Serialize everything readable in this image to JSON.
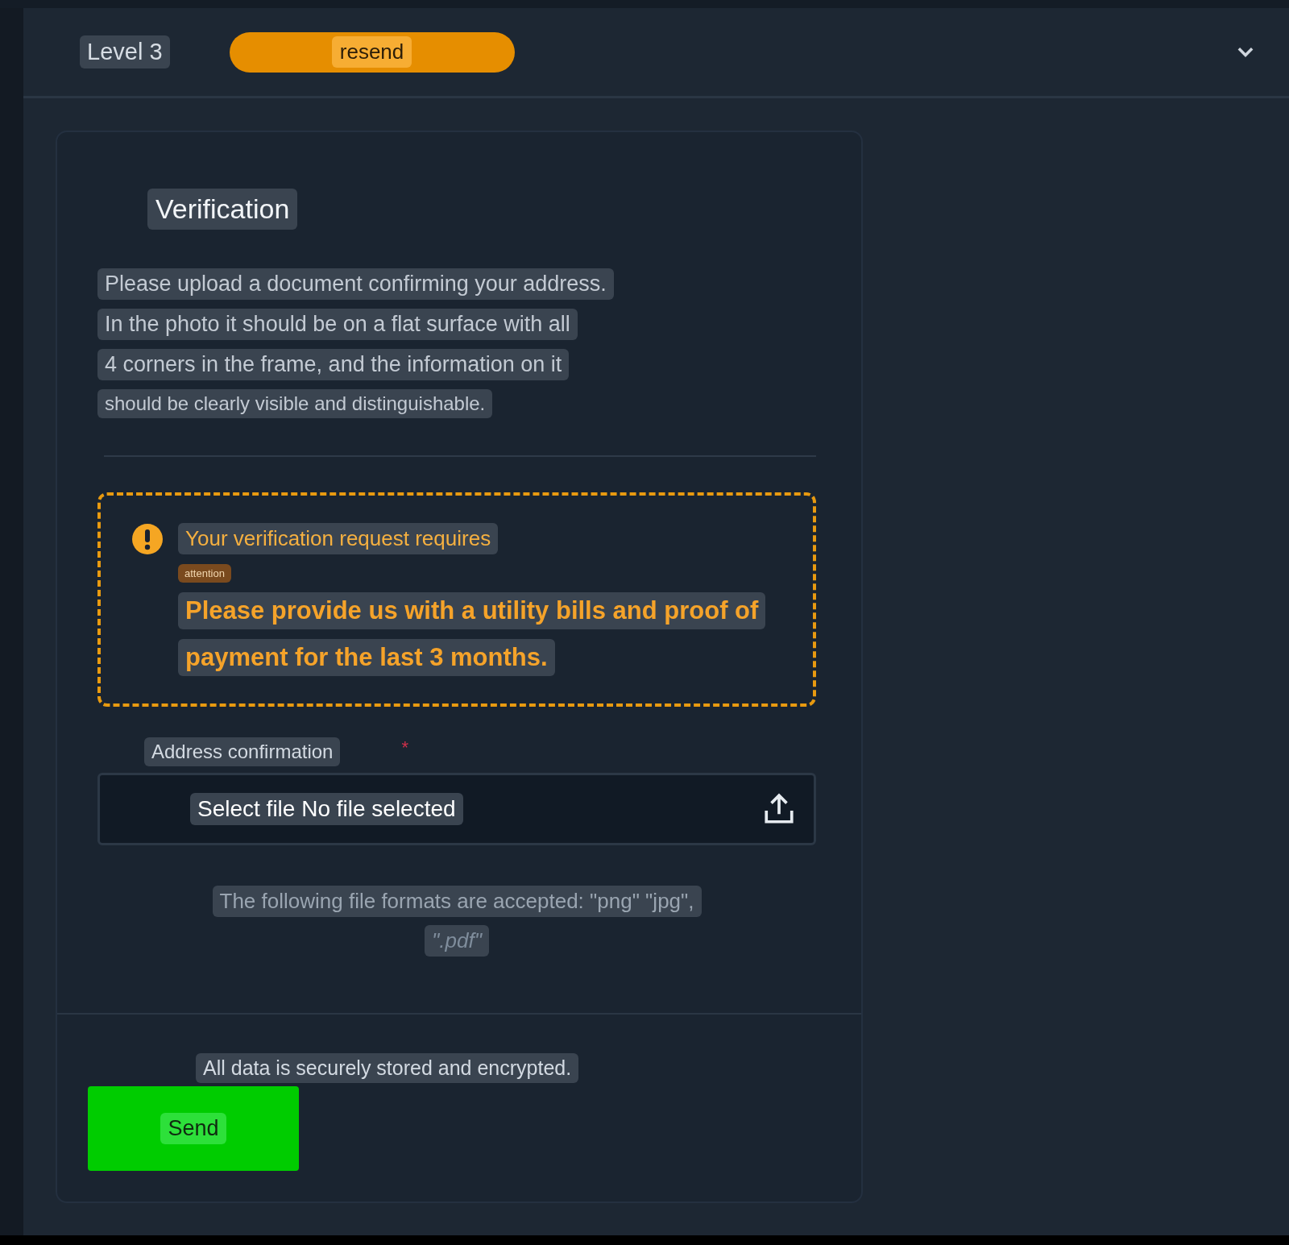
{
  "header": {
    "level": "Level 3",
    "status": "resend",
    "expanded": true
  },
  "card": {
    "title": "Verification",
    "description": [
      "Please upload a document confirming your address.",
      "In the photo it should be on a flat surface with all",
      "4 corners in the frame, and the information on it",
      "should be clearly visible and distinguishable."
    ],
    "warning": {
      "title": "Your verification request requires",
      "badge": "attention",
      "message": [
        "Please provide us with a utility bills and proof of",
        "payment for the last 3 months."
      ]
    },
    "field": {
      "label": "Address confirmation",
      "required_mark": "*",
      "value": "Select file No file selected"
    },
    "formats": [
      "The following file formats are accepted: \"png\" \"jpg\",",
      "\".pdf\""
    ],
    "footer_note": "All data is securely stored and encrypted.",
    "button": "Send"
  }
}
